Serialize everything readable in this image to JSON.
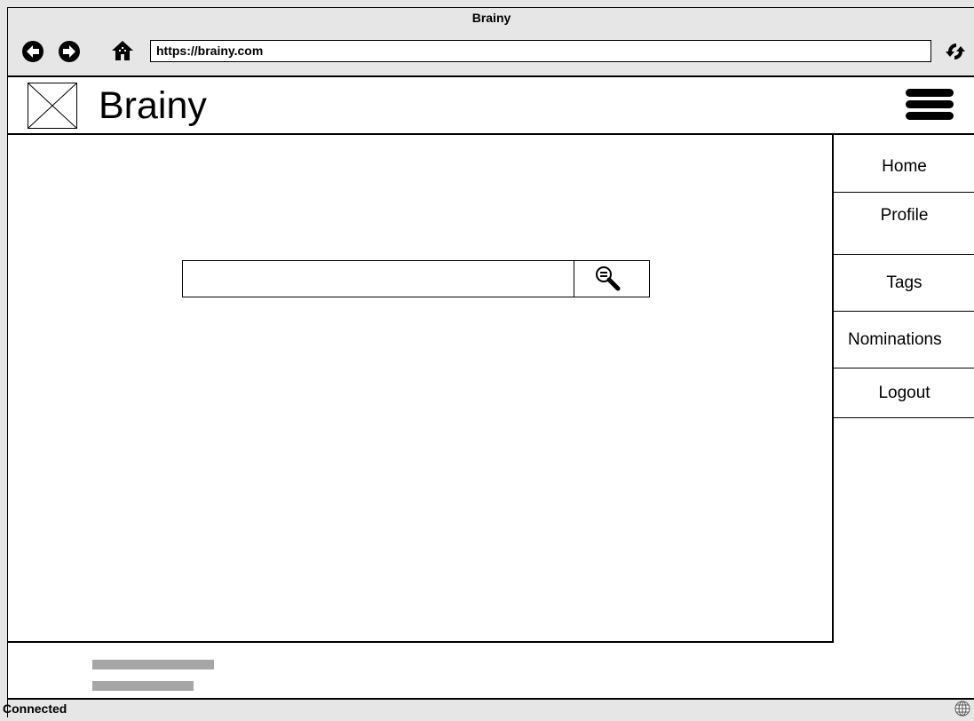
{
  "window": {
    "title": "Brainy"
  },
  "browser": {
    "url": "https://brainy.com",
    "icons": {
      "back": "back-arrow-icon",
      "forward": "forward-arrow-icon",
      "home": "home-icon",
      "reload": "reload-icon"
    }
  },
  "app": {
    "brand": "Brainy",
    "logo_icon": "image-placeholder-icon",
    "menu_icon": "hamburger-menu-icon"
  },
  "search": {
    "value": "",
    "placeholder": "",
    "button_icon": "magnifier-icon"
  },
  "sidebar": {
    "items": [
      {
        "label": "Home"
      },
      {
        "label": "Profile"
      },
      {
        "label": "Tags"
      },
      {
        "label": "Nominations"
      },
      {
        "label": "Logout"
      }
    ]
  },
  "status": {
    "text": "Connected",
    "icon": "globe-icon"
  },
  "colors": {
    "chrome": "#e6e6e6",
    "placeholder_bar": "#a6a6a6",
    "border": "#000000"
  }
}
